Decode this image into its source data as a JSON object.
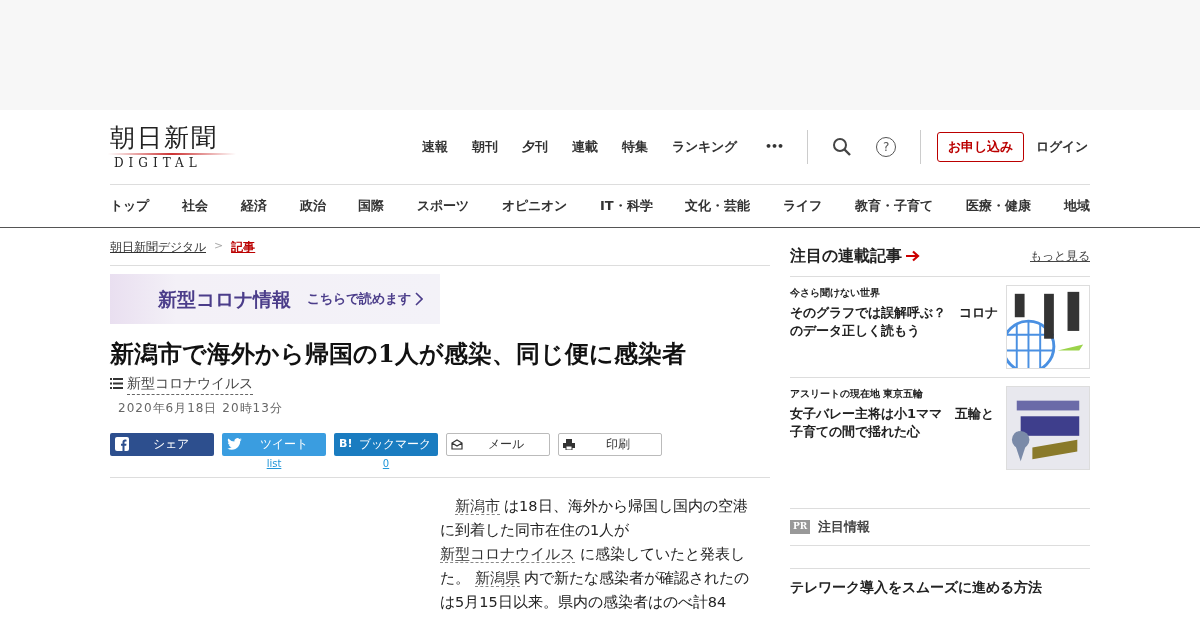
{
  "header": {
    "logo_title": "朝日新聞",
    "logo_sub": "DIGITAL",
    "top_links": [
      "速報",
      "朝刊",
      "夕刊",
      "連載",
      "特集",
      "ランキング"
    ],
    "more": "•••",
    "help": "?",
    "subscribe": "お申し込み",
    "login": "ログイン"
  },
  "nav": [
    "トップ",
    "社会",
    "経済",
    "政治",
    "国際",
    "スポーツ",
    "オピニオン",
    "IT・科学",
    "文化・芸能",
    "ライフ",
    "教育・子育て",
    "医療・健康",
    "地域"
  ],
  "breadcrumb": [
    {
      "label": "朝日新聞デジタル",
      "current": false
    },
    {
      "label": "記事",
      "current": true
    }
  ],
  "breadcrumb_separator": ">",
  "banner": {
    "title": "新型コロナ情報",
    "link": "こちらで読めます"
  },
  "article": {
    "title": "新潟市で海外から帰国の1人が感染、同じ便に感染者",
    "tag": "新型コロナウイルス",
    "date": "2020年6月18日 20時13分",
    "share": [
      {
        "kind": "facebook",
        "label": "シェア"
      },
      {
        "kind": "twitter",
        "label": "ツイート",
        "count": "list"
      },
      {
        "kind": "hatena",
        "icon_text": "B!",
        "label": "ブックマーク",
        "count": "0"
      },
      {
        "kind": "mail",
        "label": "メール"
      },
      {
        "kind": "print",
        "label": "印刷"
      }
    ],
    "body": [
      {
        "kind": "link",
        "text": "新潟市"
      },
      {
        "kind": "text",
        "text": " は18日、海外から帰国し国内の空港に到着した同市在住の1人が "
      },
      {
        "kind": "link",
        "text": "新型コロナウイルス"
      },
      {
        "kind": "text",
        "text": " に感染していたと発表した。 "
      },
      {
        "kind": "link",
        "text": "新潟県"
      },
      {
        "kind": "text",
        "text": " 内で新たな感染者が確認されたのは5月15日以来。県内の感染者はのべ計84"
      }
    ]
  },
  "sidebar": {
    "title": "注目の連載記事",
    "more": "もっと見る",
    "items": [
      {
        "series": "今さら聞けない世界",
        "headline": "そのグラフでは誤解呼ぶ？　コロナのデータ正しく読もう",
        "kind": "picture"
      },
      {
        "series": "アスリートの現在地 東京五輪",
        "headline": "女子バレー主将は小1ママ　五輪と子育ての間で揺れた心",
        "kind": "picture"
      }
    ],
    "pr": {
      "badge": "PR",
      "label": "注目情報"
    },
    "promo": {
      "headline": "テレワーク導入をスムーズに進める方法"
    }
  }
}
